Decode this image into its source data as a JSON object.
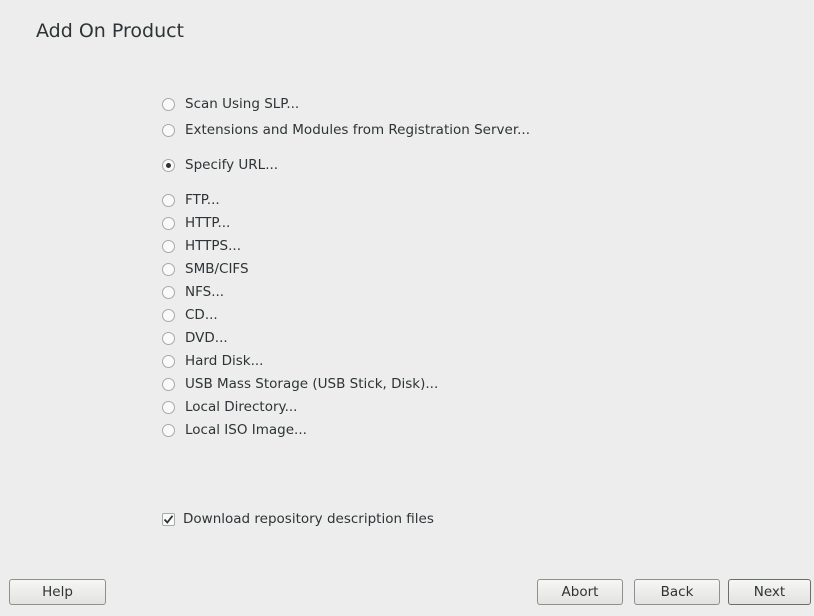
{
  "header": {
    "title": "Add On Product"
  },
  "options": [
    {
      "label": "Scan Using SLP...",
      "checked": false
    },
    {
      "label": "Extensions and Modules from Registration Server...",
      "checked": false
    },
    {
      "label": "Specify URL...",
      "checked": true
    },
    {
      "label": "FTP...",
      "checked": false
    },
    {
      "label": "HTTP...",
      "checked": false
    },
    {
      "label": "HTTPS...",
      "checked": false
    },
    {
      "label": "SMB/CIFS",
      "checked": false
    },
    {
      "label": "NFS...",
      "checked": false
    },
    {
      "label": "CD...",
      "checked": false
    },
    {
      "label": "DVD...",
      "checked": false
    },
    {
      "label": "Hard Disk...",
      "checked": false
    },
    {
      "label": "USB Mass Storage (USB Stick, Disk)...",
      "checked": false
    },
    {
      "label": "Local Directory...",
      "checked": false
    },
    {
      "label": "Local ISO Image...",
      "checked": false
    }
  ],
  "download_checkbox": {
    "label": "Download repository description files",
    "checked": true
  },
  "buttons": {
    "help": "Help",
    "abort": "Abort",
    "back": "Back",
    "next": "Next"
  }
}
